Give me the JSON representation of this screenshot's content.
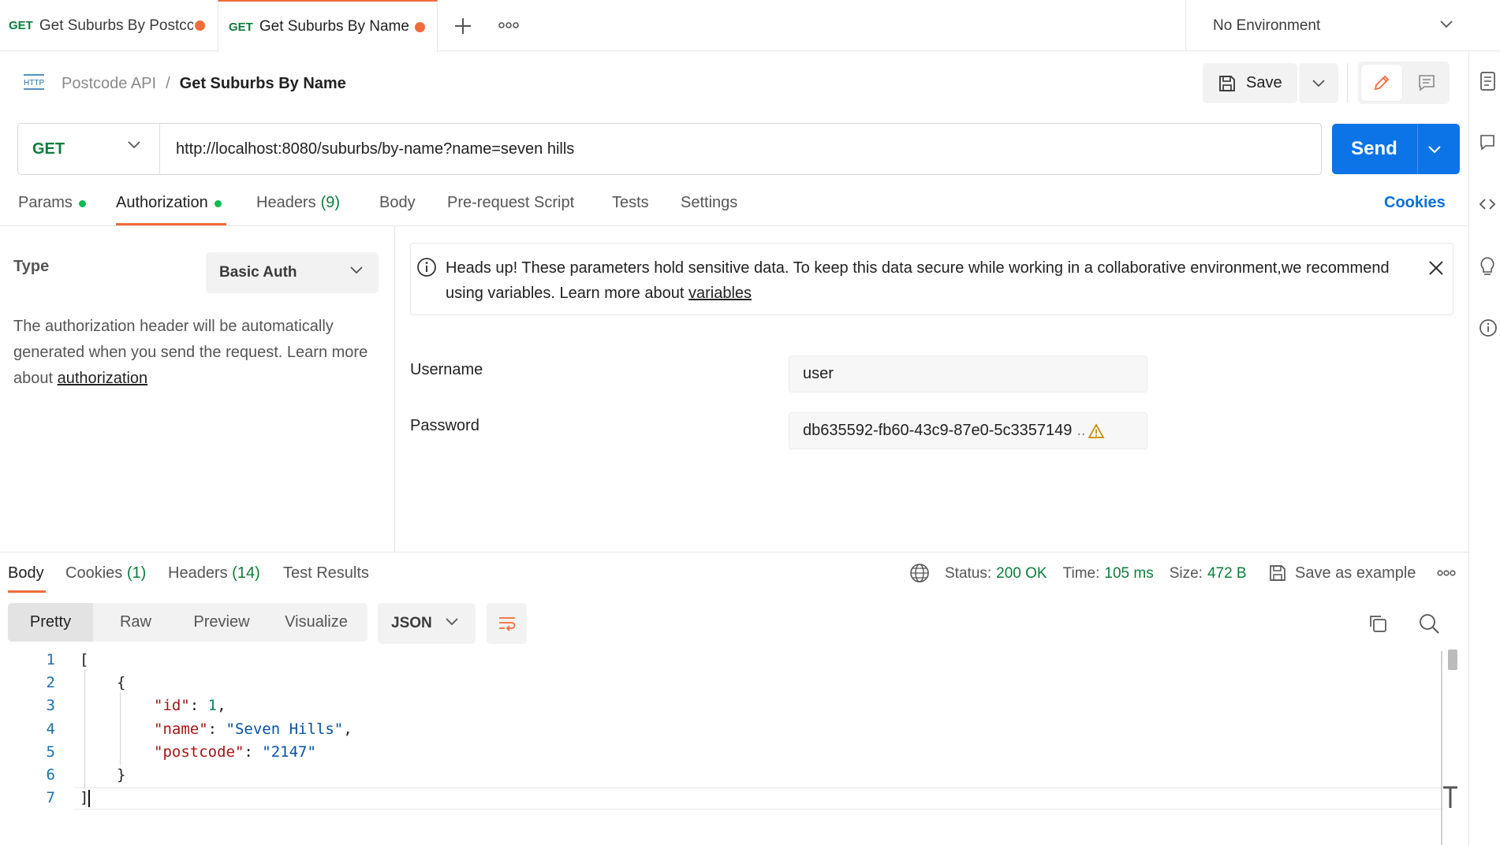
{
  "tabs": [
    {
      "method": "GET",
      "title": "Get Suburbs By Postcc"
    },
    {
      "method": "GET",
      "title": "Get Suburbs By Name"
    }
  ],
  "environment": {
    "selected": "No Environment"
  },
  "breadcrumb": {
    "collection": "Postcode API",
    "separator": "/",
    "request": "Get Suburbs By Name"
  },
  "toolbar": {
    "save_label": "Save"
  },
  "request": {
    "method": "GET",
    "url": "http://localhost:8080/suburbs/by-name?name=seven hills",
    "send_label": "Send"
  },
  "request_tabs": {
    "params": "Params",
    "authorization": "Authorization",
    "headers": "Headers",
    "headers_count": "(9)",
    "body": "Body",
    "prerequest": "Pre-request Script",
    "tests": "Tests",
    "settings": "Settings",
    "cookies": "Cookies"
  },
  "auth": {
    "type_label": "Type",
    "type_value": "Basic Auth",
    "description": "The authorization header will be automatically generated when you send the request. Learn more about ",
    "description_link": "authorization",
    "banner_text": "Heads up! These parameters hold sensitive data. To keep this data secure while working in a collaborative environment,we recommend using variables. Learn more about ",
    "banner_link": "variables",
    "username_label": "Username",
    "username_value": "user",
    "password_label": "Password",
    "password_value": "db635592-fb60-43c9-87e0-5c3357149",
    "password_overflow": ".."
  },
  "response_tabs": {
    "body": "Body",
    "cookies": "Cookies",
    "cookies_count": "(1)",
    "headers": "Headers",
    "headers_count": "(14)",
    "test_results": "Test Results"
  },
  "response_status": {
    "status_label": "Status:",
    "status_value": "200 OK",
    "time_label": "Time:",
    "time_value": "105 ms",
    "size_label": "Size:",
    "size_value": "472 B",
    "save_example": "Save as example"
  },
  "view_modes": {
    "pretty": "Pretty",
    "raw": "Raw",
    "preview": "Preview",
    "visualize": "Visualize",
    "format": "JSON"
  },
  "response_body": {
    "line_numbers": [
      "1",
      "2",
      "3",
      "4",
      "5",
      "6",
      "7"
    ],
    "open_bracket": "[",
    "open_brace": "{",
    "fields": [
      {
        "key": "\"id\"",
        "value": "1",
        "type": "number",
        "suffix": ","
      },
      {
        "key": "\"name\"",
        "value": "\"Seven Hills\"",
        "type": "string",
        "suffix": ","
      },
      {
        "key": "\"postcode\"",
        "value": "\"2147\"",
        "type": "string",
        "suffix": ""
      }
    ],
    "close_brace": "}",
    "close_bracket": "]"
  },
  "colors": {
    "accent": "#f26b3a",
    "send": "#0c74e6",
    "method": "#0b7d3b"
  }
}
